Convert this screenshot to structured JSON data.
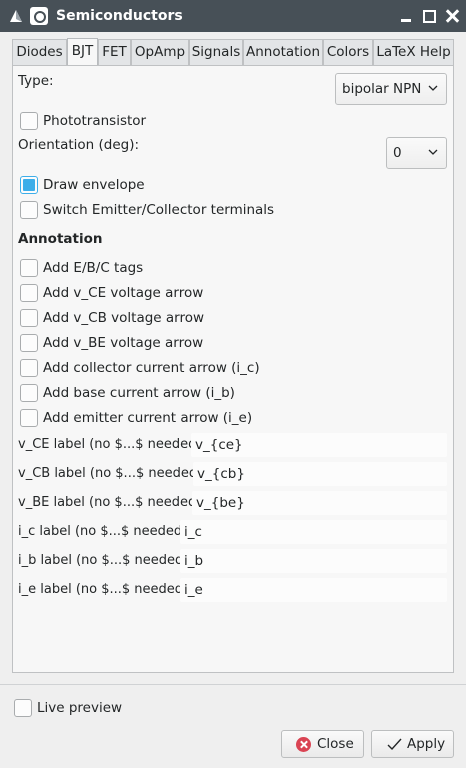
{
  "window": {
    "title": "Semiconductors"
  },
  "tabs": [
    "Diodes",
    "BJT",
    "FET",
    "OpAmp",
    "Signals",
    "Annotation",
    "Colors",
    "LaTeX Help"
  ],
  "active_tab": "BJT",
  "bjt": {
    "type_label": "Type:",
    "type_value": "bipolar NPN",
    "phototransistor_label": "Phototransistor",
    "phototransistor_checked": false,
    "orientation_label": "Orientation (deg):",
    "orientation_value": "0",
    "draw_envelope_label": "Draw envelope",
    "draw_envelope_checked": true,
    "switch_label": "Switch Emitter/Collector terminals",
    "switch_checked": false
  },
  "annotation": {
    "heading": "Annotation",
    "options": [
      {
        "label": "Add E/B/C tags",
        "checked": false
      },
      {
        "label": "Add v_CE voltage arrow",
        "checked": false
      },
      {
        "label": "Add v_CB voltage arrow",
        "checked": false
      },
      {
        "label": "Add v_BE voltage arrow",
        "checked": false
      },
      {
        "label": "Add collector current arrow (i_c)",
        "checked": false
      },
      {
        "label": "Add base current arrow (i_b)",
        "checked": false
      },
      {
        "label": "Add emitter current arrow (i_e)",
        "checked": false
      }
    ],
    "fields": [
      {
        "label": "v_CE label (no $...$ needed)",
        "value": "v_{ce}"
      },
      {
        "label": "v_CB label (no $...$ needed)",
        "value": "v_{cb}"
      },
      {
        "label": "v_BE label (no $...$ needed)",
        "value": "v_{be}"
      },
      {
        "label": "i_c label (no $...$ needed)",
        "value": "i_c"
      },
      {
        "label": "i_b label (no $...$ needed)",
        "value": "i_b"
      },
      {
        "label": "i_e label (no $...$ needed)",
        "value": "i_e"
      }
    ]
  },
  "footer": {
    "live_preview_label": "Live preview",
    "live_preview_checked": false,
    "close_label": "Close",
    "apply_label": "Apply"
  },
  "colors": {
    "titlebar": "#475057",
    "accent": "#3daee9",
    "close_icon": "#da4453"
  }
}
